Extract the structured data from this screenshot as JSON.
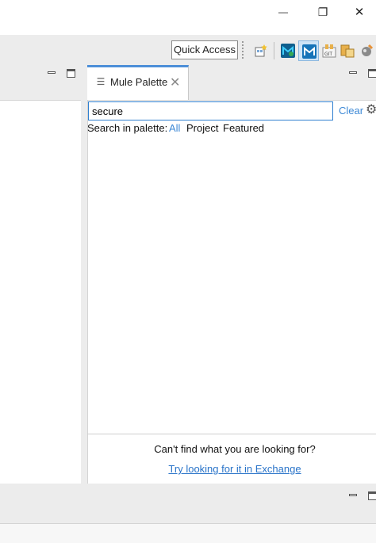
{
  "window": {
    "minimize_glyph": "—",
    "restore_glyph": "❐",
    "close_glyph": "✕"
  },
  "toolbar": {
    "quick_access_label": "Quick Access",
    "icons": [
      "new-wizard-icon",
      "mule-perspective-icon",
      "mule-design-perspective-icon",
      "git-perspective-icon",
      "java-perspective-icon",
      "debug-perspective-icon"
    ]
  },
  "palette": {
    "tab_label": "Mule Palette",
    "tab_icon_glyph": "☰",
    "tab_close_glyph": "✕",
    "search_value": "secure",
    "clear_label": "Clear",
    "gear_glyph": "⚙",
    "search_in_label": "Search in palette:",
    "filters": [
      "All",
      "Project",
      "Featured"
    ],
    "active_filter": "All",
    "footer_text": "Can't find what you are looking for?",
    "footer_link": "Try looking for it in Exchange"
  },
  "colors": {
    "accent": "#3d89d6",
    "tab_border": "#4d8fd8",
    "panel_bg": "#ececec"
  }
}
